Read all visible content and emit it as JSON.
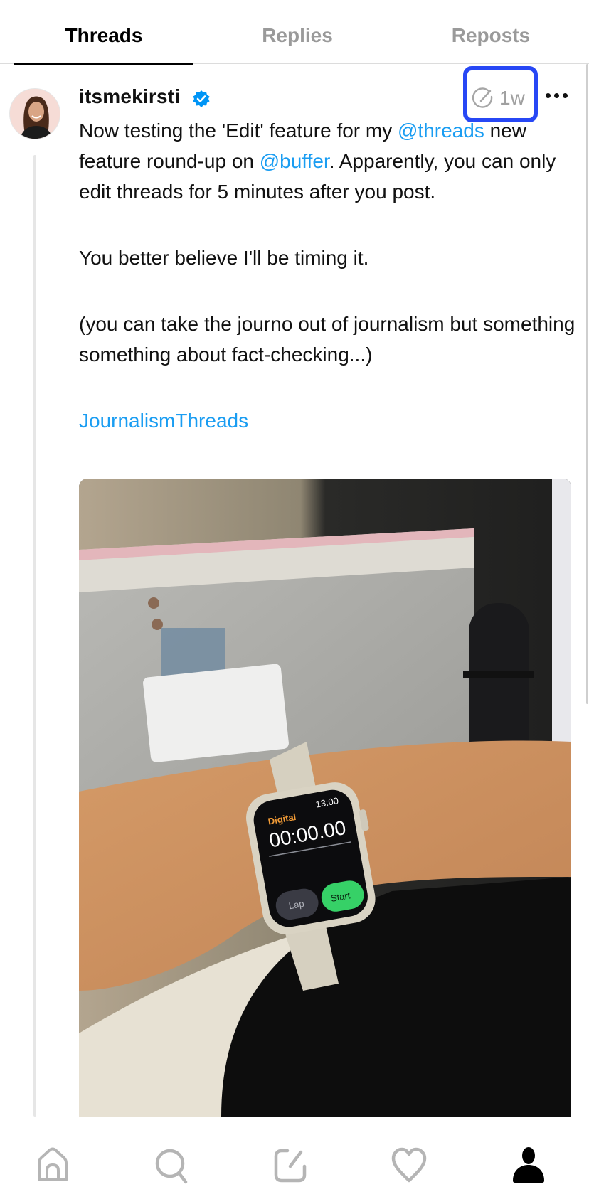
{
  "tabs": [
    {
      "label": "Threads",
      "active": true
    },
    {
      "label": "Replies",
      "active": false
    },
    {
      "label": "Reposts",
      "active": false
    }
  ],
  "post": {
    "username": "itsmekirsti",
    "verified": true,
    "timestamp": "1w",
    "edited_indicator_icon": "edit-circle-icon",
    "body": {
      "line1_before": "Now testing the 'Edit' feature for my ",
      "mention1": "@threads",
      "line2_before": " new feature round-up on ",
      "mention2": "@buffer",
      "line2_after": ". Apparently, you can only edit threads for 5 minutes after you post.",
      "paragraph2": "You better believe I'll be timing it.",
      "paragraph3": "(you can take the journo out of journalism but something something about fact-checking...)",
      "tag": "JournalismThreads"
    },
    "image": {
      "description": "Photo of a wrist wearing an Apple Watch showing a stopwatch, in front of a monitor and microphone",
      "watch_back_label": "Digital",
      "watch_time": "13:00",
      "stopwatch": "00:00.00",
      "lap_label": "Lap",
      "start_label": "Start"
    }
  },
  "bottom_nav": [
    {
      "name": "home",
      "icon": "home-icon",
      "active": false
    },
    {
      "name": "search",
      "icon": "search-icon",
      "active": false
    },
    {
      "name": "compose",
      "icon": "compose-icon",
      "active": false
    },
    {
      "name": "activity",
      "icon": "heart-icon",
      "active": false
    },
    {
      "name": "profile",
      "icon": "profile-icon",
      "active": true
    }
  ],
  "colors": {
    "link": "#1a9df2",
    "highlight_box": "#2747f5",
    "verified": "#0095f6",
    "muted": "#9a9a9a"
  }
}
